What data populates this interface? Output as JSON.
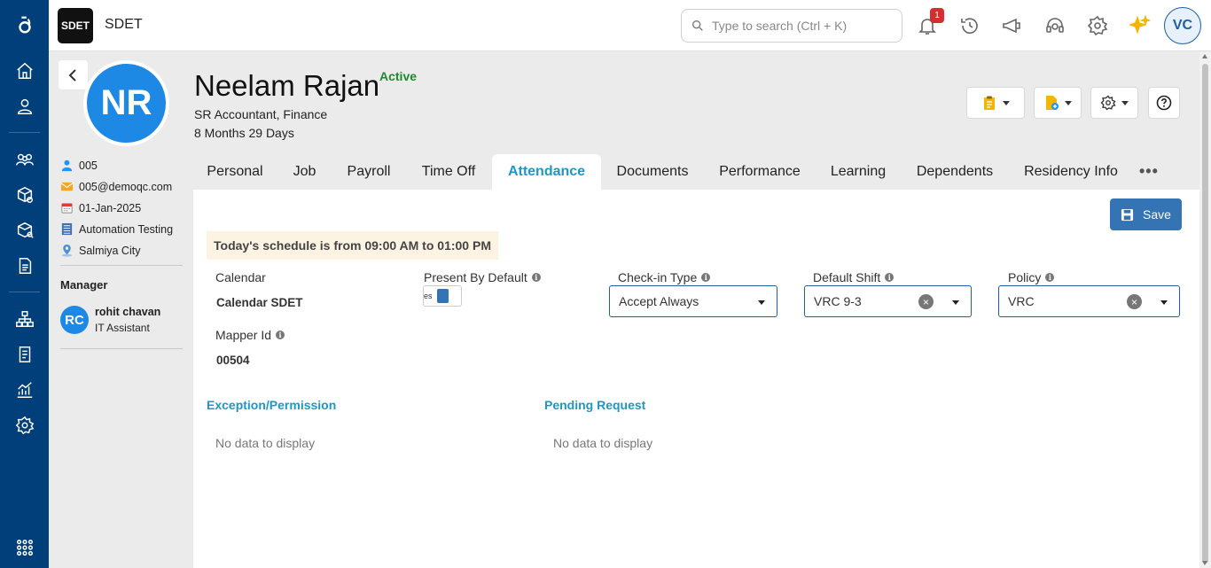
{
  "topbar": {
    "logo_text": "SDET",
    "org_name": "SDET",
    "search_placeholder": "Type to search (Ctrl + K)",
    "notification_count": "1",
    "user_initials": "VC"
  },
  "rail_icons": [
    "brand-logo-icon",
    "home-icon",
    "user-icon",
    "team-icon",
    "box-settings-icon",
    "box-search-icon",
    "document-icon",
    "org-chart-icon",
    "report-icon",
    "analytics-icon",
    "settings-icon",
    "apps-grid-icon"
  ],
  "profile": {
    "initials": "NR",
    "name": "Neelam Rajan",
    "status": "Active",
    "role": "SR Accountant, Finance",
    "tenure": "8 Months 29 Days",
    "employee_id": "005",
    "email": "005@demoqc.com",
    "join_date": "01-Jan-2025",
    "department": "Automation Testing",
    "location": "Salmiya City"
  },
  "manager": {
    "label": "Manager",
    "initials": "RC",
    "name": "rohit chavan",
    "title": "IT Assistant"
  },
  "tabs": [
    "Personal",
    "Job",
    "Payroll",
    "Time Off",
    "Attendance",
    "Documents",
    "Performance",
    "Learning",
    "Dependents",
    "Residency Info"
  ],
  "active_tab": "Attendance",
  "attendance": {
    "save_label": "Save",
    "schedule_text": "Today's schedule is from 09:00 AM to 01:00 PM",
    "calendar_label": "Calendar",
    "calendar_value": "Calendar SDET",
    "present_by_default_label": "Present By Default",
    "present_toggle_text": "es",
    "checkin_type_label": "Check-in Type",
    "checkin_type_value": "Accept Always",
    "default_shift_label": "Default Shift",
    "default_shift_value": "VRC 9-3",
    "policy_label": "Policy",
    "policy_value": "VRC",
    "mapper_id_label": "Mapper Id",
    "mapper_id_value": "00504",
    "exception_title": "Exception/Permission",
    "exception_empty": "No data to display",
    "pending_title": "Pending Request",
    "pending_empty": "No data to display"
  },
  "colors": {
    "rail": "#003f7a",
    "accent": "#2196c4",
    "save_button": "#3474b4",
    "status_active": "#1e8a2e",
    "avatar": "#1e88e5"
  }
}
